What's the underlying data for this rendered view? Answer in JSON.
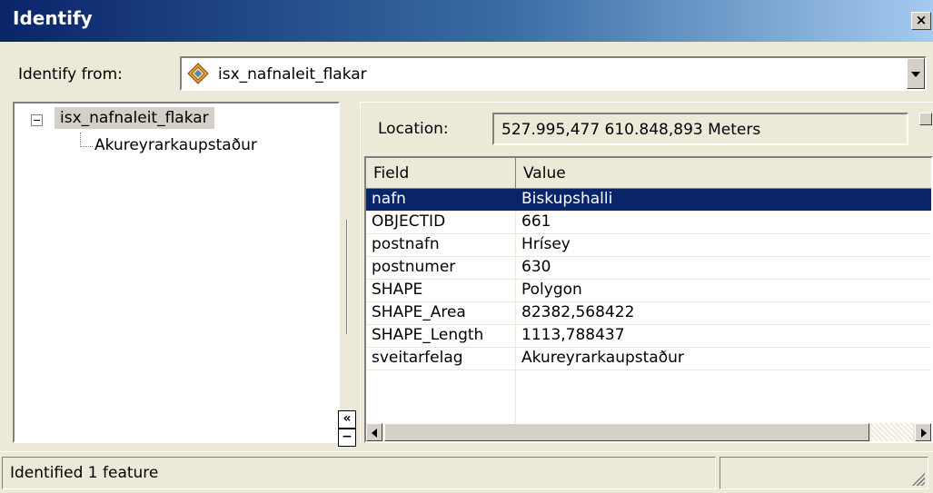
{
  "window": {
    "title": "Identify"
  },
  "identify_from": {
    "label": "Identify from:",
    "value": "isx_nafnaleit_flakar",
    "icon": "layer-icon"
  },
  "tree": {
    "root": "isx_nafnaleit_flakar",
    "child": "Akureyrarkaupstaður"
  },
  "location": {
    "label": "Location:",
    "value": "527.995,477  610.848,893 Meters"
  },
  "grid": {
    "headers": [
      "Field",
      "Value"
    ],
    "rows": [
      [
        "nafn",
        "Biskupshalli"
      ],
      [
        "OBJECTID",
        "661"
      ],
      [
        "postnafn",
        "Hrísey"
      ],
      [
        "postnumer",
        "630"
      ],
      [
        "SHAPE",
        "Polygon"
      ],
      [
        "SHAPE_Area",
        "82382,568422"
      ],
      [
        "SHAPE_Length",
        "1113,788437"
      ],
      [
        "sveitarfelag",
        "Akureyrarkaupstaður"
      ]
    ],
    "selected_row": 0
  },
  "status": {
    "text": "Identified 1 feature"
  },
  "buttons": {
    "close": "×",
    "expand": "«",
    "collapse": "−"
  },
  "colors": {
    "selection": "#0a246a",
    "titlebar_start": "#0a246a",
    "titlebar_end": "#a6caf0"
  }
}
